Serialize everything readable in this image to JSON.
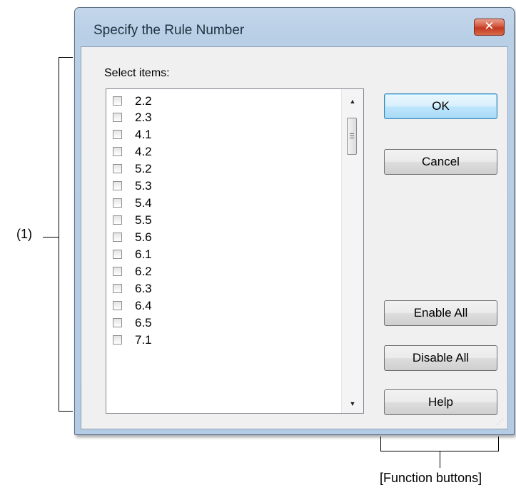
{
  "annotation": {
    "region_label": "(1)",
    "function_buttons_label": "[Function buttons]"
  },
  "dialog": {
    "title": "Specify the Rule Number",
    "close_glyph": "✕",
    "select_items_label": "Select items:",
    "items": [
      {
        "label": "2.2",
        "checked": false
      },
      {
        "label": "2.3",
        "checked": false
      },
      {
        "label": "4.1",
        "checked": false
      },
      {
        "label": "4.2",
        "checked": false
      },
      {
        "label": "5.2",
        "checked": false
      },
      {
        "label": "5.3",
        "checked": false
      },
      {
        "label": "5.4",
        "checked": false
      },
      {
        "label": "5.5",
        "checked": false
      },
      {
        "label": "5.6",
        "checked": false
      },
      {
        "label": "6.1",
        "checked": false
      },
      {
        "label": "6.2",
        "checked": false
      },
      {
        "label": "6.3",
        "checked": false
      },
      {
        "label": "6.4",
        "checked": false
      },
      {
        "label": "6.5",
        "checked": false
      },
      {
        "label": "7.1",
        "checked": false
      }
    ],
    "buttons": {
      "ok": "OK",
      "cancel": "Cancel",
      "enable_all": "Enable All",
      "disable_all": "Disable All",
      "help": "Help"
    }
  }
}
